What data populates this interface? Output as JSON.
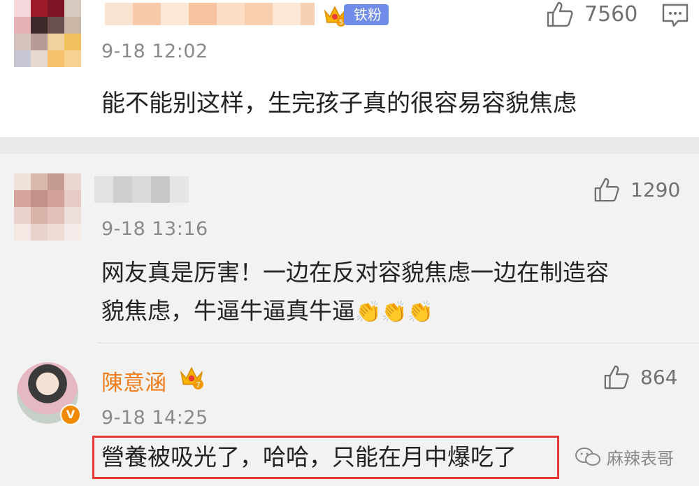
{
  "comments": [
    {
      "fan_badge": "铁粉",
      "crown_level": "5",
      "time": "9-18 12:02",
      "likes": "7560",
      "text": "能不能别这样，生完孩子真的很容易容貌焦虑"
    },
    {
      "time": "9-18 13:16",
      "likes": "1290",
      "text_line1": "网友真是厉害！一边在反对容貌焦虑一边在制造容",
      "text_line2": "貌焦虑，牛逼牛逼真牛逼",
      "emoji": "👏👏👏"
    },
    {
      "username": "陳意涵",
      "crown_level": "7",
      "verified": "V",
      "time": "9-18 14:25",
      "likes": "864",
      "text": "營養被吸光了，哈哈，只能在月中爆吃了"
    }
  ],
  "watermark": "麻辣表哥",
  "colors": {
    "username": "#f07c1a",
    "highlight": "#e53935",
    "badge": "#6f8de8"
  }
}
